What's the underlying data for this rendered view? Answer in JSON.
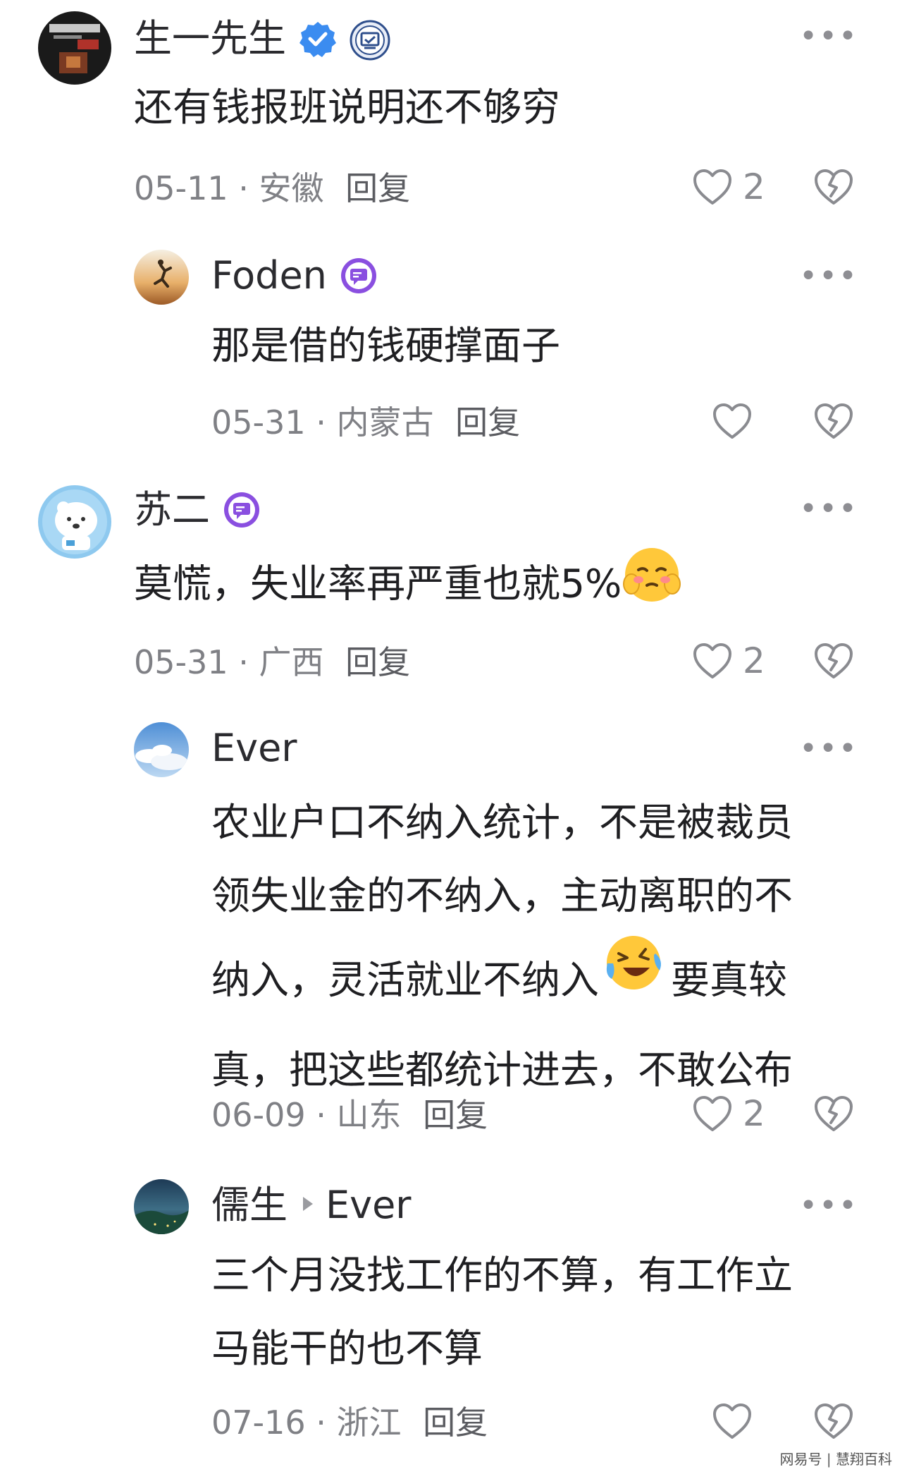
{
  "comments": [
    {
      "name": "生一先生",
      "body_lines": [
        "还有钱报班说明还不够穷"
      ],
      "date": "05-11",
      "location": "安徽",
      "reply_label": "回复",
      "likes": "2"
    },
    {
      "name": "Foden",
      "body_lines": [
        "那是借的钱硬撑面子"
      ],
      "date": "05-31",
      "location": "内蒙古",
      "reply_label": "回复",
      "likes": ""
    },
    {
      "name": "苏二",
      "body_lines": [
        "莫慌，失业率再严重也就5%"
      ],
      "date": "05-31",
      "location": "广西",
      "reply_label": "回复",
      "likes": "2"
    },
    {
      "name": "Ever",
      "body_lines": [
        "农业户口不纳入统计，不是被裁员",
        "领失业金的不纳入，主动离职的不",
        "纳入，灵活就业不纳入",
        "要真较",
        "真，把这些都统计进去，不敢公布"
      ],
      "date": "06-09",
      "location": "山东",
      "reply_label": "回复",
      "likes": "2"
    },
    {
      "name": "儒生",
      "reply_to": "Ever",
      "body_lines": [
        "三个月没找工作的不算，有工作立",
        "马能干的也不算"
      ],
      "date": "07-16",
      "location": "浙江",
      "reply_label": "回复",
      "likes": ""
    }
  ],
  "more_glyph": "•••",
  "separator": "·",
  "watermark": "网易号 | 慧翔百科",
  "colors": {
    "verified_blue": "#3b8cf0",
    "badge_purple": "#8a4fe0",
    "icon_gray": "#8a8b90"
  }
}
